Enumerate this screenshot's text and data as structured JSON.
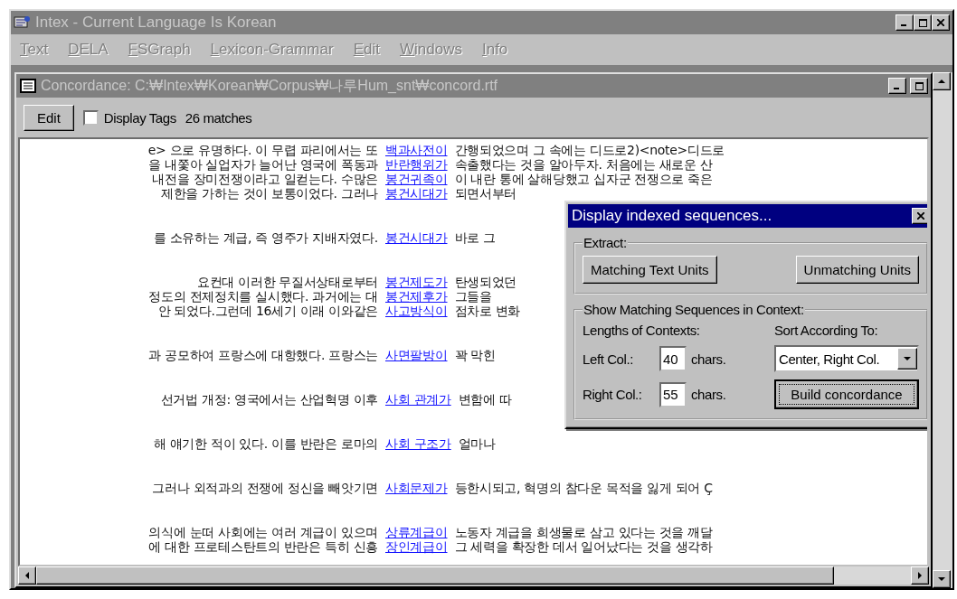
{
  "window": {
    "title": "Intex - Current Language Is Korean"
  },
  "menu": [
    "Text",
    "DELA",
    "FSGraph",
    "Lexicon-Grammar",
    "Edit",
    "Windows",
    "Info"
  ],
  "concordance": {
    "title": "Concordance: C:₩Intex₩Korean₩Corpus₩나루Hum_snt₩concord.rtf",
    "edit_button": "Edit",
    "display_tags": {
      "label": "Display Tags",
      "checked": false
    },
    "matches": "26 matches",
    "blocks": [
      [
        {
          "left": "e> 으로 유명하다. 이 무렵 파리에서는 또",
          "match": "백과사전이",
          "right": "간행되었으며 그 속에는 디드로2)<note>디드로"
        },
        {
          "left": "을 내쫓아 실업자가 늘어난 영국에 폭동과",
          "match": "반란행위가",
          "right": "속출했다는 것을 알아두자. 처음에는 새로운 산"
        },
        {
          "left": "내전을 장미전쟁이라고 일컫는다. 수많은",
          "match": "봉건귀족이",
          "right": "이 내란 통에 살해당했고 십자군 전쟁으로 죽은"
        },
        {
          "left": "제한을 가하는 것이 보통이었다. 그러나",
          "match": "봉건시대가",
          "right": "되면서부터"
        }
      ],
      [
        {
          "left": "를 소유하는 계급, 즉 영주가 지배자였다.",
          "match": "봉건시대가",
          "right": "바로 그"
        }
      ],
      [
        {
          "left": "요컨대 이러한 무질서상태로부터",
          "match": "봉건제도가",
          "right": "탄생되었던"
        },
        {
          "left": "정도의 전제정치를 실시했다. 과거에는 대",
          "match": "봉건제후가",
          "right": "그들을"
        },
        {
          "left": "안 되었다.그런데 16세기 이래 이와같은",
          "match": "사고방식이",
          "right": "점차로 변화"
        }
      ],
      [
        {
          "left": "과 공모하여 프랑스에 대항했다. 프랑스는",
          "match": "사면팔방이",
          "right": "꽉 막힌"
        }
      ],
      [
        {
          "left": "선거법 개정: 영국에서는 산업혁명 이후",
          "match": "사회 관계가",
          "right": "변함에 따"
        }
      ],
      [
        {
          "left": "해 얘기한 적이 있다. 이를 반란은 로마의",
          "match": "사회 구조가",
          "right": "얼마나"
        }
      ],
      [
        {
          "left": "그러나 외적과의 전쟁에 정신을 빼앗기면",
          "match": "사회문제가",
          "right": "등한시되고, 혁명의 참다운 목적을 잃게 되어 Ç"
        }
      ],
      [
        {
          "left": "의식에 눈떠 사회에는 여러 계급이 있으며",
          "match": "상류계급이",
          "right": "노동자 계급을 희생물로 삼고 있다는 것을 깨달"
        },
        {
          "left": "에 대한 프로테스탄트의 반란은 특히 신흥",
          "match": "장인계급이",
          "right": "그 세력을 확장한 데서 일어났다는 것을 생각하"
        }
      ]
    ]
  },
  "dialog": {
    "title": "Display indexed sequences...",
    "extract": {
      "legend": "Extract:",
      "buttons": [
        "Matching Text Units",
        "Unmatching Units"
      ]
    },
    "context": {
      "legend": "Show Matching Sequences in Context:",
      "lengths_label": "Lengths of Contexts:",
      "sort_label": "Sort According To:",
      "left_col": {
        "label": "Left Col.:",
        "value": "40",
        "unit": "chars."
      },
      "right_col": {
        "label": "Right Col.:",
        "value": "55",
        "unit": "chars."
      },
      "sort": "Center, Right Col.",
      "build_button": {
        "label": "Build concordance",
        "default": true
      }
    }
  }
}
